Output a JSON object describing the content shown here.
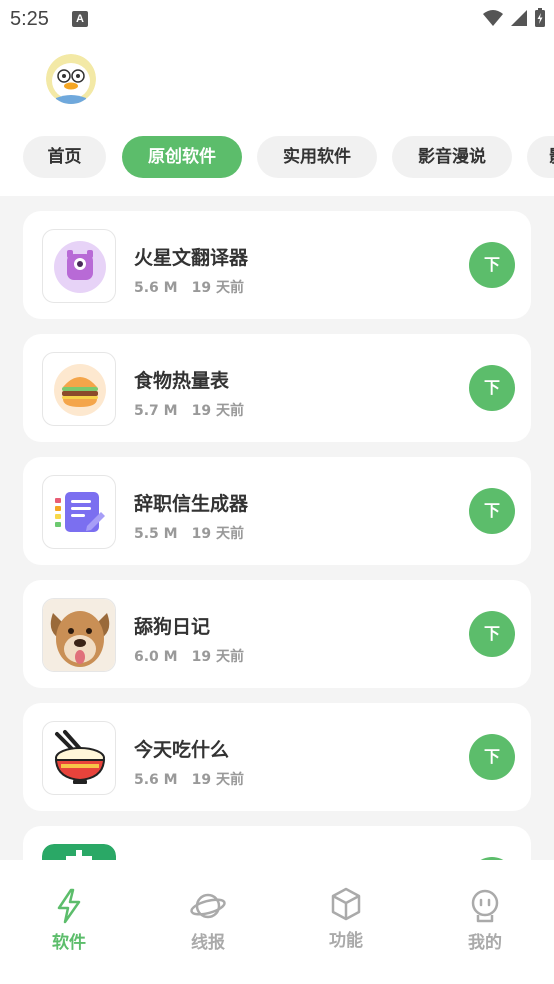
{
  "status_bar": {
    "time": "5:25",
    "notification_letter": "A"
  },
  "tabs": [
    {
      "label": "首页",
      "active": false
    },
    {
      "label": "原创软件",
      "active": true
    },
    {
      "label": "实用软件",
      "active": false
    },
    {
      "label": "影音漫说",
      "active": false
    },
    {
      "label": "影",
      "active": false
    }
  ],
  "apps": [
    {
      "name": "火星文翻译器",
      "size": "5.6 M",
      "time": "19 天前",
      "download_label": "下",
      "icon": "monster-icon"
    },
    {
      "name": "食物热量表",
      "size": "5.7 M",
      "time": "19 天前",
      "download_label": "下",
      "icon": "burger-icon"
    },
    {
      "name": "辞职信生成器",
      "size": "5.5 M",
      "time": "19 天前",
      "download_label": "下",
      "icon": "document-edit-icon"
    },
    {
      "name": "舔狗日记",
      "size": "6.0 M",
      "time": "19 天前",
      "download_label": "下",
      "icon": "dog-icon"
    },
    {
      "name": "今天吃什么",
      "size": "5.6 M",
      "time": "19 天前",
      "download_label": "下",
      "icon": "rice-bowl-icon"
    },
    {
      "name": "",
      "size": "",
      "time": "",
      "download_label": "",
      "icon": "partial-app-icon"
    }
  ],
  "bottom_nav": [
    {
      "label": "软件",
      "icon": "lightning-icon",
      "active": true
    },
    {
      "label": "线报",
      "icon": "planet-icon",
      "active": false
    },
    {
      "label": "功能",
      "icon": "cube-icon",
      "active": false
    },
    {
      "label": "我的",
      "icon": "robot-icon",
      "active": false
    }
  ],
  "colors": {
    "accent": "#5cbd6b",
    "background": "#f4f4f4",
    "card": "#ffffff",
    "inactive": "#aaaaaa"
  }
}
